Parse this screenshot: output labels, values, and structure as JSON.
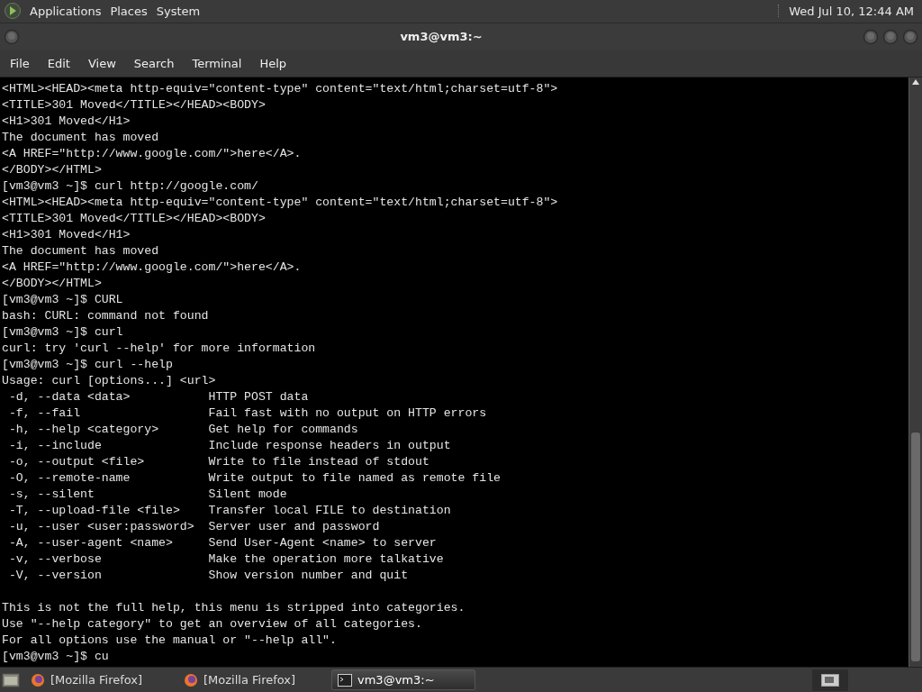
{
  "top_panel": {
    "menus": [
      "Applications",
      "Places",
      "System"
    ],
    "clock": "Wed Jul 10, 12:44 AM"
  },
  "window": {
    "title": "vm3@vm3:~"
  },
  "menu_bar": [
    "File",
    "Edit",
    "View",
    "Search",
    "Terminal",
    "Help"
  ],
  "terminal": {
    "output_blocks": [
      [
        "<HTML><HEAD><meta http-equiv=\"content-type\" content=\"text/html;charset=utf-8\">",
        "<TITLE>301 Moved</TITLE></HEAD><BODY>",
        "<H1>301 Moved</H1>",
        "The document has moved",
        "<A HREF=\"http://www.google.com/\">here</A>.",
        "</BODY></HTML>",
        "[vm3@vm3 ~]$ curl http://google.com/",
        "<HTML><HEAD><meta http-equiv=\"content-type\" content=\"text/html;charset=utf-8\">",
        "<TITLE>301 Moved</TITLE></HEAD><BODY>",
        "<H1>301 Moved</H1>",
        "The document has moved",
        "<A HREF=\"http://www.google.com/\">here</A>.",
        "</BODY></HTML>",
        "[vm3@vm3 ~]$ CURL",
        "bash: CURL: command not found",
        "[vm3@vm3 ~]$ curl",
        "curl: try 'curl --help' for more information",
        "[vm3@vm3 ~]$ curl --help",
        "Usage: curl [options...] <url>",
        " -d, --data <data>           HTTP POST data",
        " -f, --fail                  Fail fast with no output on HTTP errors",
        " -h, --help <category>       Get help for commands",
        " -i, --include               Include response headers in output",
        " -o, --output <file>         Write to file instead of stdout",
        " -O, --remote-name           Write output to file named as remote file",
        " -s, --silent                Silent mode",
        " -T, --upload-file <file>    Transfer local FILE to destination",
        " -u, --user <user:password>  Server user and password",
        " -A, --user-agent <name>     Send User-Agent <name> to server",
        " -v, --verbose               Make the operation more talkative",
        " -V, --version               Show version number and quit"
      ],
      [
        "This is not the full help, this menu is stripped into categories.",
        "Use \"--help category\" to get an overview of all categories.",
        "For all options use the manual or \"--help all\".",
        "[vm3@vm3 ~]$ cu"
      ]
    ]
  },
  "taskbar": {
    "tasks": [
      {
        "kind": "browser",
        "label": "[Mozilla Firefox]",
        "selected": false
      },
      {
        "kind": "browser",
        "label": "[Mozilla Firefox]",
        "selected": false
      },
      {
        "kind": "terminal",
        "label": "vm3@vm3:~",
        "selected": true
      }
    ]
  }
}
